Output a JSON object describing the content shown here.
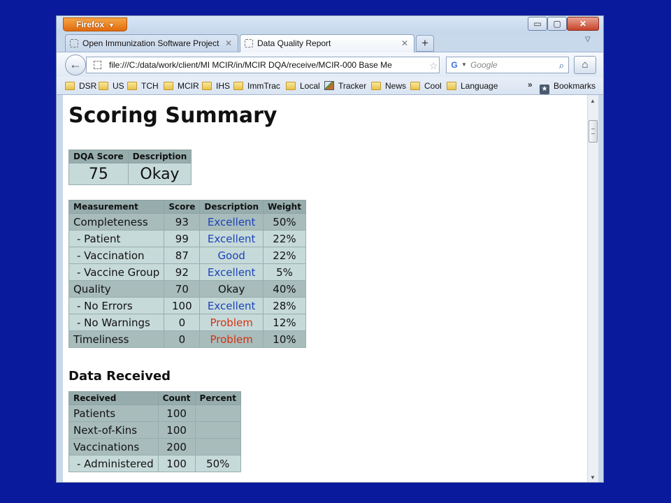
{
  "browser": {
    "app_button": "Firefox",
    "window_controls": {
      "minimize": "▭",
      "maximize": "▢",
      "close": "✕"
    },
    "tabs": [
      {
        "label": "Open Immunization Software Project",
        "active": false
      },
      {
        "label": "Data Quality Report",
        "active": true
      }
    ],
    "new_tab": "+",
    "url": "file:///C:/data/work/client/MI MCIR/in/MCIR DQA/receive/MCIR-000 Base Me",
    "search_placeholder": "Google",
    "bookmarks": [
      "DSR",
      "US",
      "TCH",
      "MCIR",
      "IHS",
      "ImmTrac",
      "Local",
      "Tracker",
      "News",
      "Cool",
      "Language"
    ],
    "bookmarks_overflow": "»",
    "bookmarks_menu": "Bookmarks"
  },
  "report": {
    "title": "Scoring Summary",
    "dqa": {
      "headers": [
        "DQA Score",
        "Description"
      ],
      "score": "75",
      "description": "Okay"
    },
    "measurement": {
      "headers": [
        "Measurement",
        "Score",
        "Description",
        "Weight"
      ],
      "rows": [
        {
          "name": "Completeness",
          "score": "93",
          "description": "Excellent",
          "weight": "50%",
          "level": 1,
          "status": "excellent"
        },
        {
          "name": "- Patient",
          "score": "99",
          "description": "Excellent",
          "weight": "22%",
          "level": 2,
          "status": "excellent"
        },
        {
          "name": "- Vaccination",
          "score": "87",
          "description": "Good",
          "weight": "22%",
          "level": 2,
          "status": "good"
        },
        {
          "name": "- Vaccine Group",
          "score": "92",
          "description": "Excellent",
          "weight": "5%",
          "level": 2,
          "status": "excellent"
        },
        {
          "name": "Quality",
          "score": "70",
          "description": "Okay",
          "weight": "40%",
          "level": 1,
          "status": "okay"
        },
        {
          "name": "- No Errors",
          "score": "100",
          "description": "Excellent",
          "weight": "28%",
          "level": 2,
          "status": "excellent"
        },
        {
          "name": "- No Warnings",
          "score": "0",
          "description": "Problem",
          "weight": "12%",
          "level": 2,
          "status": "problem"
        },
        {
          "name": "Timeliness",
          "score": "0",
          "description": "Problem",
          "weight": "10%",
          "level": 1,
          "status": "problem"
        }
      ]
    },
    "data_received": {
      "heading": "Data Received",
      "headers": [
        "Received",
        "Count",
        "Percent"
      ],
      "rows": [
        {
          "name": "Patients",
          "count": "100",
          "percent": "",
          "level": 1
        },
        {
          "name": "Next-of-Kins",
          "count": "100",
          "percent": "",
          "level": 1
        },
        {
          "name": "Vaccinations",
          "count": "200",
          "percent": "",
          "level": 1
        },
        {
          "name": "- Administered",
          "count": "100",
          "percent": "50%",
          "level": 2
        }
      ]
    }
  },
  "colors": {
    "desktop": "#0a1a9c",
    "header_bg": "#97adad",
    "excellent": "#1b44b8",
    "problem": "#d6320e"
  }
}
